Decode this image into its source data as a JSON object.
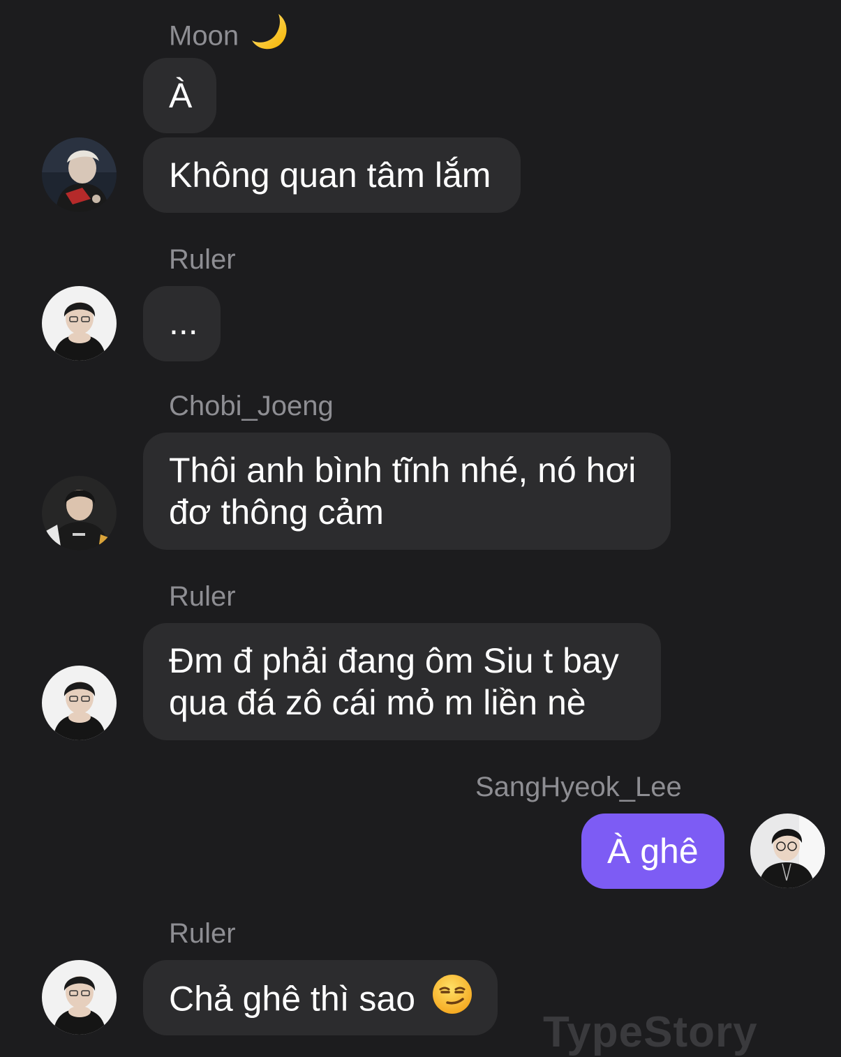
{
  "messages": [
    {
      "sender": "Moon",
      "text_1": "À",
      "text_2": "Không quan tâm lắm"
    },
    {
      "sender": "Ruler",
      "text": "..."
    },
    {
      "sender": "Chobi_Joeng",
      "line_1": "Thôi anh bình tĩnh nhé, nó hơi",
      "line_2": "đơ thông cảm"
    },
    {
      "sender": "Ruler",
      "line_1": "Đm đ phải đang ôm Siu t bay",
      "line_2": "qua đá zô cái mỏ m liền nè"
    },
    {
      "sender": "SangHyeok_Lee",
      "text": "À ghê",
      "outgoing": true
    },
    {
      "sender": "Ruler",
      "text": "Chả ghê thì sao"
    }
  ],
  "icons": {
    "moon": "crescent-moon-emoji",
    "smirk": "smirking-face-emoji"
  },
  "colors": {
    "background": "#1c1c1e",
    "bubble_incoming": "#2c2c2e",
    "bubble_outgoing": "#7d5cf4",
    "sender_name": "#8e8e93"
  },
  "watermark": "TypeStory"
}
